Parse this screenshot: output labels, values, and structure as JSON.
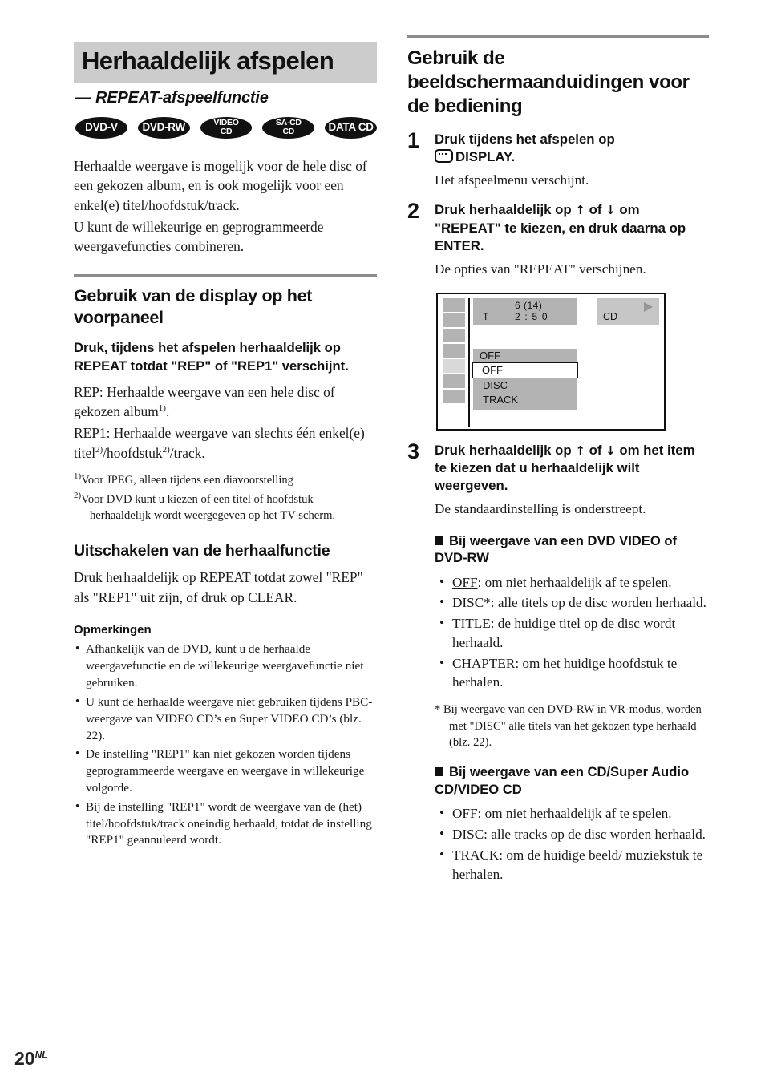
{
  "page": {
    "number": "20",
    "language_suffix": "NL"
  },
  "left_column": {
    "title": "Herhaaldelijk afspelen",
    "subtitle": "— REPEAT-afspeelfunctie",
    "badges": [
      {
        "name": "dvd-v",
        "lines": [
          "DVD-V"
        ]
      },
      {
        "name": "dvd-rw",
        "lines": [
          "DVD-RW"
        ]
      },
      {
        "name": "video-cd",
        "lines": [
          "VIDEO",
          "CD"
        ]
      },
      {
        "name": "sa-cd",
        "lines": [
          "SA-CD",
          "CD"
        ]
      },
      {
        "name": "data-cd",
        "lines": [
          "DATA CD"
        ]
      }
    ],
    "intro_paragraph_1": "Herhaalde weergave is mogelijk voor de hele disc of een gekozen album, en is ook mogelijk voor een enkel(e) titel/hoofdstuk/track.",
    "intro_paragraph_2": "U kunt de willekeurige en geprogrammeerde weergavefuncties combineren.",
    "section_display": {
      "heading": "Gebruik van de display op het voorpaneel",
      "lead": "Druk, tijdens het afspelen herhaaldelijk op REPEAT totdat \"REP\" of \"REP1\" verschijnt.",
      "rep_line": "REP: Herhaalde weergave van een hele disc of gekozen album",
      "rep_line_suffix": ".",
      "rep1_line_a": "REP1: Herhaalde weergave van slechts één enkel(e) titel",
      "rep1_line_b": "/hoofdstuk",
      "rep1_line_c": "/track.",
      "footnote_1_mark": "1)",
      "footnote_1": "Voor JPEG, alleen tijdens een diavoorstelling",
      "footnote_2_mark": "2)",
      "footnote_2": "Voor DVD kunt u kiezen of een titel of hoofdstuk herhaaldelijk wordt weergegeven op het TV-scherm."
    },
    "section_off": {
      "heading": "Uitschakelen van de herhaalfunctie",
      "text": "Druk herhaaldelijk op REPEAT totdat zowel \"REP\" als \"REP1\" uit zijn, of druk op CLEAR."
    },
    "notes": {
      "heading": "Opmerkingen",
      "items": [
        "Afhankelijk van de DVD, kunt u de herhaalde weergavefunctie en de willekeurige weergavefunctie niet gebruiken.",
        "U kunt de herhaalde weergave niet gebruiken tijdens PBC-weergave van VIDEO CD’s en Super VIDEO CD’s (blz. 22).",
        "De instelling \"REP1\" kan niet gekozen worden tijdens geprogrammeerde weergave en weergave in willekeurige volgorde.",
        "Bij de instelling \"REP1\" wordt de weergave van de (het) titel/hoofdstuk/track oneindig herhaald, totdat de instelling \"REP1\" geannuleerd wordt."
      ]
    }
  },
  "right_column": {
    "heading": "Gebruik de beeldschermaanduidingen voor de bediening",
    "steps": [
      {
        "number": "1",
        "title_before_icon": "Druk tijdens het afspelen op",
        "icon": "display-screen-icon",
        "title_after_icon": "DISPLAY.",
        "description": "Het afspeelmenu verschijnt."
      },
      {
        "number": "2",
        "title_part_1": "Druk herhaaldelijk op",
        "arrow_up": "↑",
        "title_part_2": "of",
        "arrow_down": "↓",
        "title_part_3": "om \"REPEAT\" te kiezen, en druk daarna op ENTER.",
        "description": "De opties van \"REPEAT\" verschijnen."
      },
      {
        "number": "3",
        "title_part_1": "Druk herhaaldelijk op",
        "arrow_up": "↑",
        "title_part_2": "of",
        "arrow_down": "↓",
        "title_part_3": "om het item te kiezen dat u herhaaldelijk wilt weergeven.",
        "description": "De standaardinstelling is onderstreept."
      }
    ],
    "osd": {
      "track_number": "6 (14)",
      "time_prefix": "T",
      "time": "2 : 5 0",
      "disc_type": "CD",
      "play_icon": "play-triangle-icon",
      "current_setting": "OFF",
      "options": [
        {
          "label": "OFF",
          "highlighted": true
        },
        {
          "label": "DISC",
          "highlighted": false
        },
        {
          "label": "TRACK",
          "highlighted": false
        }
      ],
      "icon_cells": 7,
      "selected_icon_cell_index": 4
    },
    "dvd_section": {
      "heading": "Bij weergave van een DVD VIDEO of DVD-RW",
      "options": [
        {
          "term": "OFF",
          "underlined": true,
          "text": ": om niet herhaaldelijk af te spelen."
        },
        {
          "term": "DISC*",
          "underlined": false,
          "text": ": alle titels op de disc worden herhaald."
        },
        {
          "term": "TITLE",
          "underlined": false,
          "text": ": de huidige titel op de disc wordt herhaald."
        },
        {
          "term": "CHAPTER",
          "underlined": false,
          "text": ": om het huidige hoofdstuk te herhalen."
        }
      ],
      "star_note": "* Bij weergave van een DVD-RW in VR-modus, worden met \"DISC\" alle titels van het gekozen type herhaald (blz. 22)."
    },
    "cd_section": {
      "heading": "Bij weergave van een CD/Super Audio CD/VIDEO CD",
      "options": [
        {
          "term": "OFF",
          "underlined": true,
          "text": ": om niet herhaaldelijk af te spelen."
        },
        {
          "term": "DISC",
          "underlined": false,
          "text": ": alle tracks op de disc worden herhaald."
        },
        {
          "term": "TRACK",
          "underlined": false,
          "text": ": om de huidige beeld/ muziekstuk te herhalen."
        }
      ]
    }
  },
  "colors": {
    "banner_gray": "#cccccc",
    "rule_gray": "#8c8c8c",
    "osd_panel_gray": "#b3b3b3",
    "osd_disc_gray": "#c6c6c6",
    "osd_selected_cell": "#d9d9d9",
    "badge_black": "#111111"
  }
}
